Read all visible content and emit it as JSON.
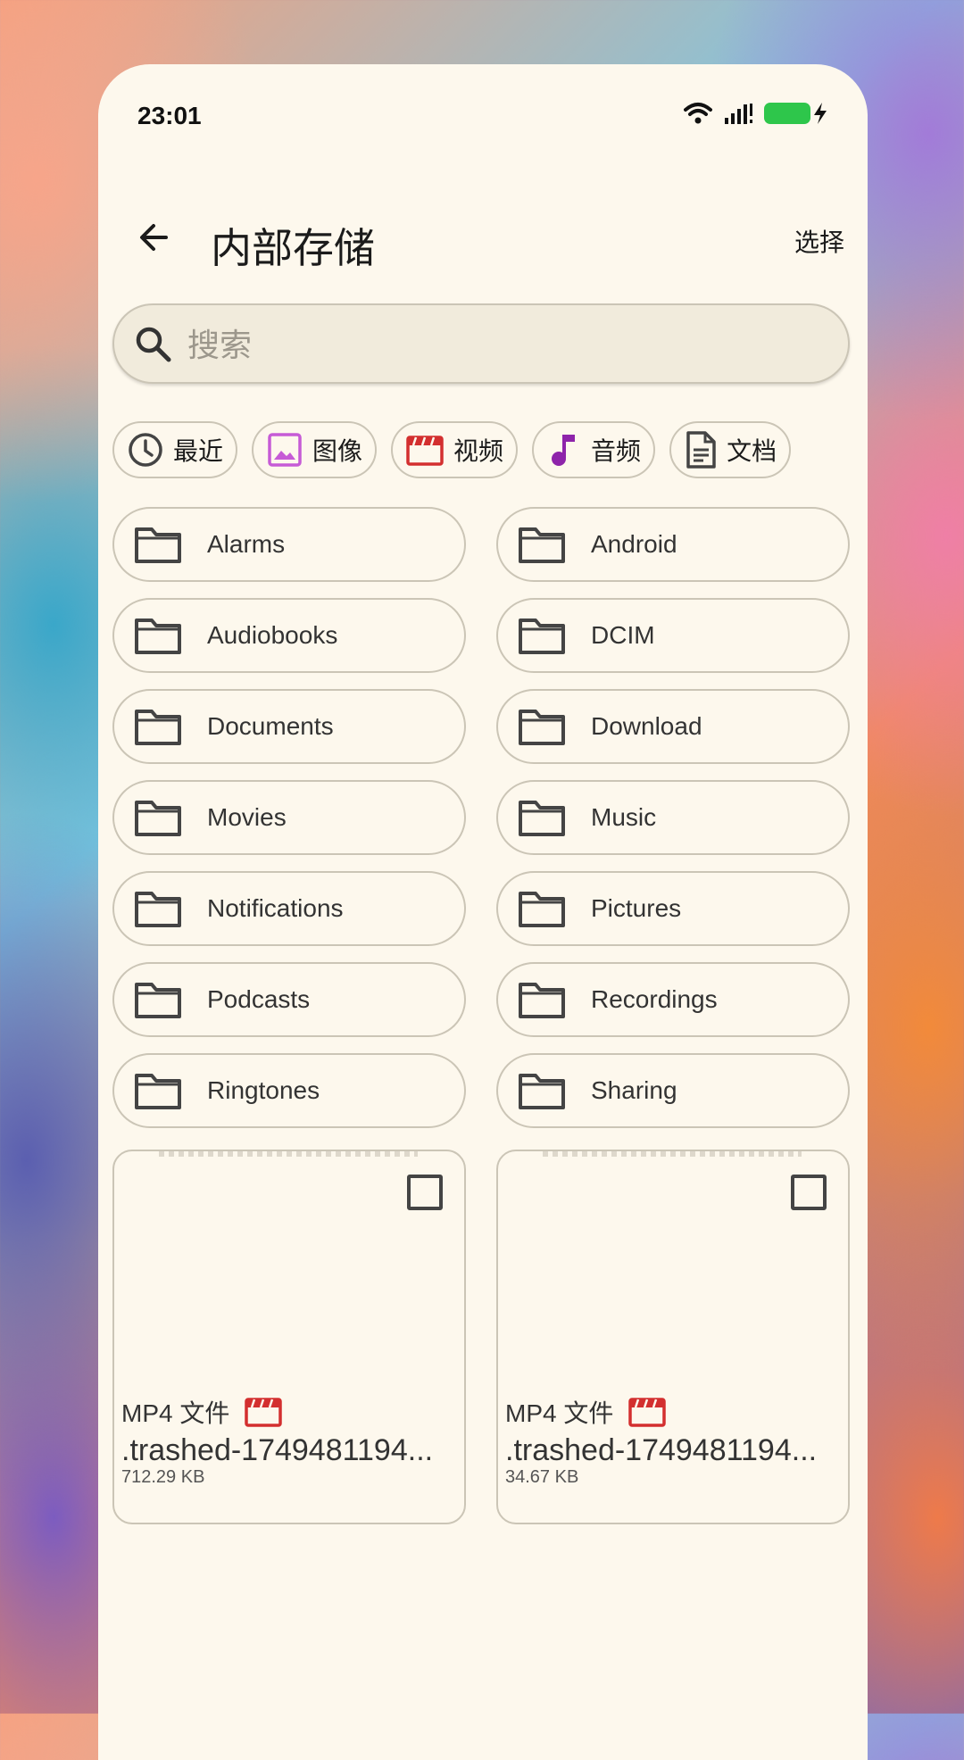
{
  "status_bar": {
    "time": "23:01"
  },
  "appbar": {
    "title": "内部存储",
    "select_label": "选择"
  },
  "search": {
    "placeholder": "搜索"
  },
  "chips": [
    {
      "label": "最近",
      "icon": "clock-icon"
    },
    {
      "label": "图像",
      "icon": "image-icon"
    },
    {
      "label": "视频",
      "icon": "video-icon"
    },
    {
      "label": "音频",
      "icon": "music-note-icon"
    },
    {
      "label": "文档",
      "icon": "document-icon"
    }
  ],
  "folders": [
    "Alarms",
    "Android",
    "Audiobooks",
    "DCIM",
    "Documents",
    "Download",
    "Movies",
    "Music",
    "Notifications",
    "Pictures",
    "Podcasts",
    "Recordings",
    "Ringtones",
    "Sharing"
  ],
  "files": [
    {
      "type": "MP4 文件",
      "name": ".trashed-1749481194...",
      "size": "712.29 KB"
    },
    {
      "type": "MP4 文件",
      "name": ".trashed-1749481194...",
      "size": "34.67 KB"
    }
  ],
  "colors": {
    "background": "#fdf8ed",
    "video_red": "#d32f2f",
    "image_purple": "#c65bd6",
    "music_purple": "#8e24aa",
    "battery_green": "#2ec64b"
  }
}
